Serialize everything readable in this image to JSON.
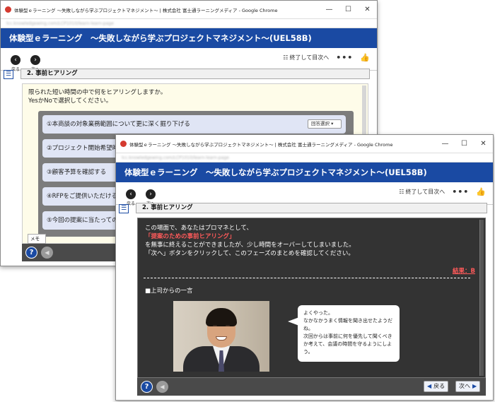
{
  "window1": {
    "title": "体験型ｅラーニング ～失敗しながら学ぶプロジェクトマネジメント～ | 株式会社 富士通ラーニングメディア - Google Chrome",
    "url": "lcc.knowledgewing.com/LCP1010/learn-learn-page",
    "app_title": "体験型ｅラーニング　～失敗しながら学ぶプロジェクトマネジメント～(UEL58B)",
    "nav": {
      "back": "戻る",
      "next": "次へ",
      "exit": "終了して目次へ"
    },
    "section": "2.  事前ヒアリング",
    "question_line1": "限られた短い時間の中で何をヒアリングしますか。",
    "question_line2": "YesかNoで選択してください。",
    "options": [
      "①本商談の対象業務範囲について更に深く掘り下げる",
      "②プロジェクト開始希望時",
      "③顧客予算を確認する",
      "④RFPをご提供いただける",
      "⑤今回の提案に当たっての"
    ],
    "select_label": "回答選択",
    "memo": "メモ"
  },
  "window2": {
    "title": "体験型ｅラーニング ～失敗しながら学ぶプロジェクトマネジメント～ | 株式会社 富士通ラーニングメディア - Google Chrome",
    "url": "lcc.knowledgewing.com/LCP1010/learn-learn-page",
    "app_title": "体験型ｅラーニング　～失敗しながら学ぶプロジェクトマネジメント～(UEL58B)",
    "nav": {
      "back": "戻る",
      "next": "次へ",
      "exit": "終了して目次へ"
    },
    "section": "2.  事前ヒアリング",
    "body_line1": "この場面で、あなたはプロマネとして、",
    "body_highlight": "「提案のための事前ヒアリング」",
    "body_line3": "を無事に終えることができましたが、少し時間をオーバーしてしまいました。",
    "body_line4": "「次へ」ボタンをクリックして、このフェーズのまとめを確認してください。",
    "grade": "結果：B",
    "boss_label": "■上司からの一言",
    "speech": [
      "よくやった。",
      "なかなかうまく情報を聞き出せたようだね。",
      "次回からは事前に何を優先して聞くべきか考えて、会議の時間を守るようにしよう。"
    ],
    "footer": {
      "back": "戻る",
      "next": "次へ"
    }
  }
}
